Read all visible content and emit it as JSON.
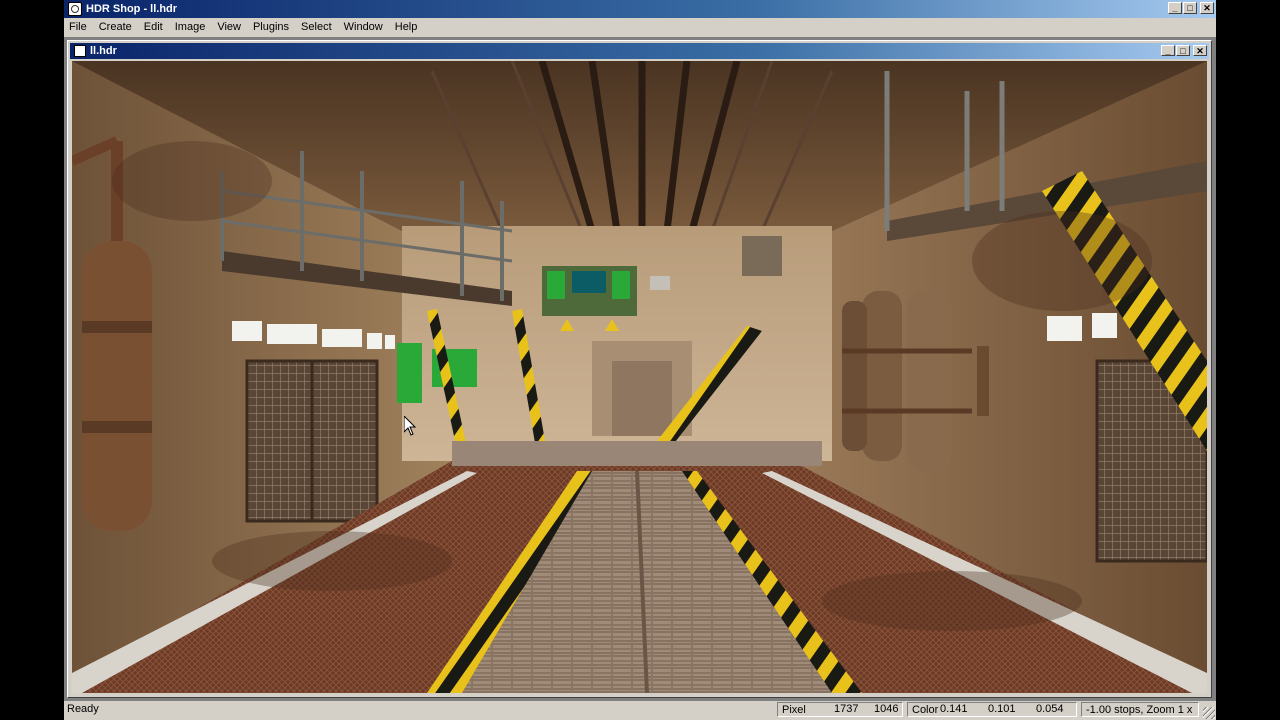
{
  "window": {
    "title": "HDR Shop - ll.hdr",
    "controls": {
      "minimize": "_",
      "maximize": "□",
      "close": "✕"
    }
  },
  "menu": [
    "File",
    "Create",
    "Edit",
    "Image",
    "View",
    "Plugins",
    "Select",
    "Window",
    "Help"
  ],
  "document": {
    "title": "ll.hdr",
    "image_description_icon": "hdr-image"
  },
  "status": {
    "ready": "Ready",
    "pixel_label": "Pixel",
    "pixel_x": "1737",
    "pixel_y": "1046",
    "color_label": "Color",
    "color_r": "0.141",
    "color_g": "0.101",
    "color_b": "0.054",
    "view_info": "-1.00 stops, Zoom 1 x"
  },
  "colors": {
    "titlebar_start": "#0a246a",
    "titlebar_end": "#a6caf0",
    "face": "#d4d0c8",
    "mdi_bg": "#808080",
    "hazard_yellow": "#e8c21a"
  }
}
